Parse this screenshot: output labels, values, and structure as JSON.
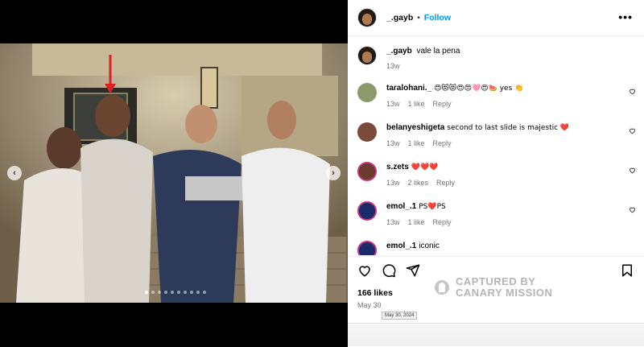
{
  "post": {
    "author": "_.gayb",
    "separator": "•",
    "follow_label": "Follow",
    "more_label": "•••",
    "caption": {
      "user": "_.gayb",
      "text": "vale la pena",
      "time": "13w"
    },
    "carousel": {
      "total_slides": 10,
      "active_slide": 1,
      "prev_label": "‹",
      "next_label": "›"
    },
    "likes": "166 likes",
    "date": "May 30",
    "date_tooltip": "May 30, 2024",
    "watermark": {
      "line1": "CAPTURED BY",
      "line2": "CANARY MISSION"
    }
  },
  "comments": [
    {
      "user": "taralohani._",
      "text": "😍😻😻😍😍🩷😍🍉 yes 👏",
      "time": "13w",
      "likes": "1 like",
      "reply": "Reply",
      "avatar_color": "#8a9a6a"
    },
    {
      "user": "belanyeshigeta",
      "text": "second to last slide is majestic ❤️",
      "time": "13w",
      "likes": "1 like",
      "reply": "Reply",
      "avatar_color": "#7a4a3a"
    },
    {
      "user": "s.zets",
      "text": "❤️❤️❤️",
      "time": "13w",
      "likes": "2 likes",
      "reply": "Reply",
      "avatar_color": "#6a3a2a"
    },
    {
      "user": "emol_.1",
      "text": "PS❤️PS",
      "time": "13w",
      "likes": "1 like",
      "reply": "Reply",
      "avatar_color": "#1a2a6a"
    },
    {
      "user": "emol_.1",
      "text": "iconic",
      "time": "",
      "likes": "",
      "reply": "",
      "avatar_color": "#1a2a6a"
    }
  ],
  "icons": [
    "heart-icon",
    "comment-icon",
    "share-icon",
    "bookmark-icon"
  ]
}
